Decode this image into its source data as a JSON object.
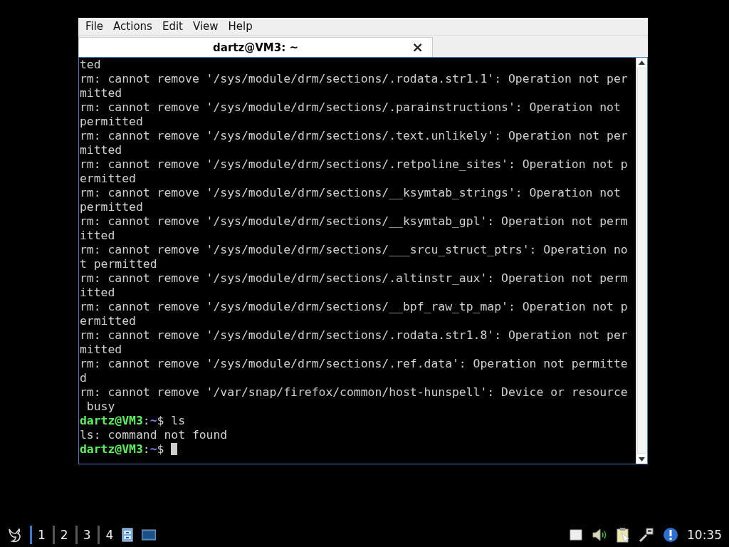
{
  "window": {
    "menu": [
      "File",
      "Actions",
      "Edit",
      "View",
      "Help"
    ],
    "tabs": [
      {
        "title": "dartz@VM3: ~",
        "close": "×",
        "selected": true
      }
    ]
  },
  "terminal": {
    "lines": [
      {
        "kind": "output",
        "text": "ted"
      },
      {
        "kind": "output",
        "text": "rm: cannot remove '/sys/module/drm/sections/.rodata.str1.1': Operation not per"
      },
      {
        "kind": "output",
        "text": "mitted"
      },
      {
        "kind": "output",
        "text": "rm: cannot remove '/sys/module/drm/sections/.parainstructions': Operation not"
      },
      {
        "kind": "output",
        "text": "permitted"
      },
      {
        "kind": "output",
        "text": "rm: cannot remove '/sys/module/drm/sections/.text.unlikely': Operation not per"
      },
      {
        "kind": "output",
        "text": "mitted"
      },
      {
        "kind": "output",
        "text": "rm: cannot remove '/sys/module/drm/sections/.retpoline_sites': Operation not p"
      },
      {
        "kind": "output",
        "text": "ermitted"
      },
      {
        "kind": "output",
        "text": "rm: cannot remove '/sys/module/drm/sections/__ksymtab_strings': Operation not"
      },
      {
        "kind": "output",
        "text": "permitted"
      },
      {
        "kind": "output",
        "text": "rm: cannot remove '/sys/module/drm/sections/__ksymtab_gpl': Operation not perm"
      },
      {
        "kind": "output",
        "text": "itted"
      },
      {
        "kind": "output",
        "text": "rm: cannot remove '/sys/module/drm/sections/___srcu_struct_ptrs': Operation no"
      },
      {
        "kind": "output",
        "text": "t permitted"
      },
      {
        "kind": "output",
        "text": "rm: cannot remove '/sys/module/drm/sections/.altinstr_aux': Operation not perm"
      },
      {
        "kind": "output",
        "text": "itted"
      },
      {
        "kind": "output",
        "text": "rm: cannot remove '/sys/module/drm/sections/__bpf_raw_tp_map': Operation not p"
      },
      {
        "kind": "output",
        "text": "ermitted"
      },
      {
        "kind": "output",
        "text": "rm: cannot remove '/sys/module/drm/sections/.rodata.str1.8': Operation not per"
      },
      {
        "kind": "output",
        "text": "mitted"
      },
      {
        "kind": "output",
        "text": "rm: cannot remove '/sys/module/drm/sections/.ref.data': Operation not permitte"
      },
      {
        "kind": "output",
        "text": "d"
      },
      {
        "kind": "output",
        "text": "rm: cannot remove '/var/snap/firefox/common/host-hunspell': Device or resource"
      },
      {
        "kind": "output",
        "text": " busy"
      },
      {
        "kind": "prompt",
        "user_host": "dartz@VM3",
        "separator": ":",
        "path": "~",
        "symbol": "$",
        "command": "ls",
        "cursor": false
      },
      {
        "kind": "output",
        "text": "ls: command not found"
      },
      {
        "kind": "prompt",
        "user_host": "dartz@VM3",
        "separator": ":",
        "path": "~",
        "symbol": "$",
        "cursor": true
      }
    ]
  },
  "taskbar": {
    "desktops": [
      {
        "label": "1",
        "selected": true
      },
      {
        "label": "2",
        "selected": false
      },
      {
        "label": "3",
        "selected": false
      },
      {
        "label": "4",
        "selected": false
      }
    ],
    "clock": "10:35"
  }
}
